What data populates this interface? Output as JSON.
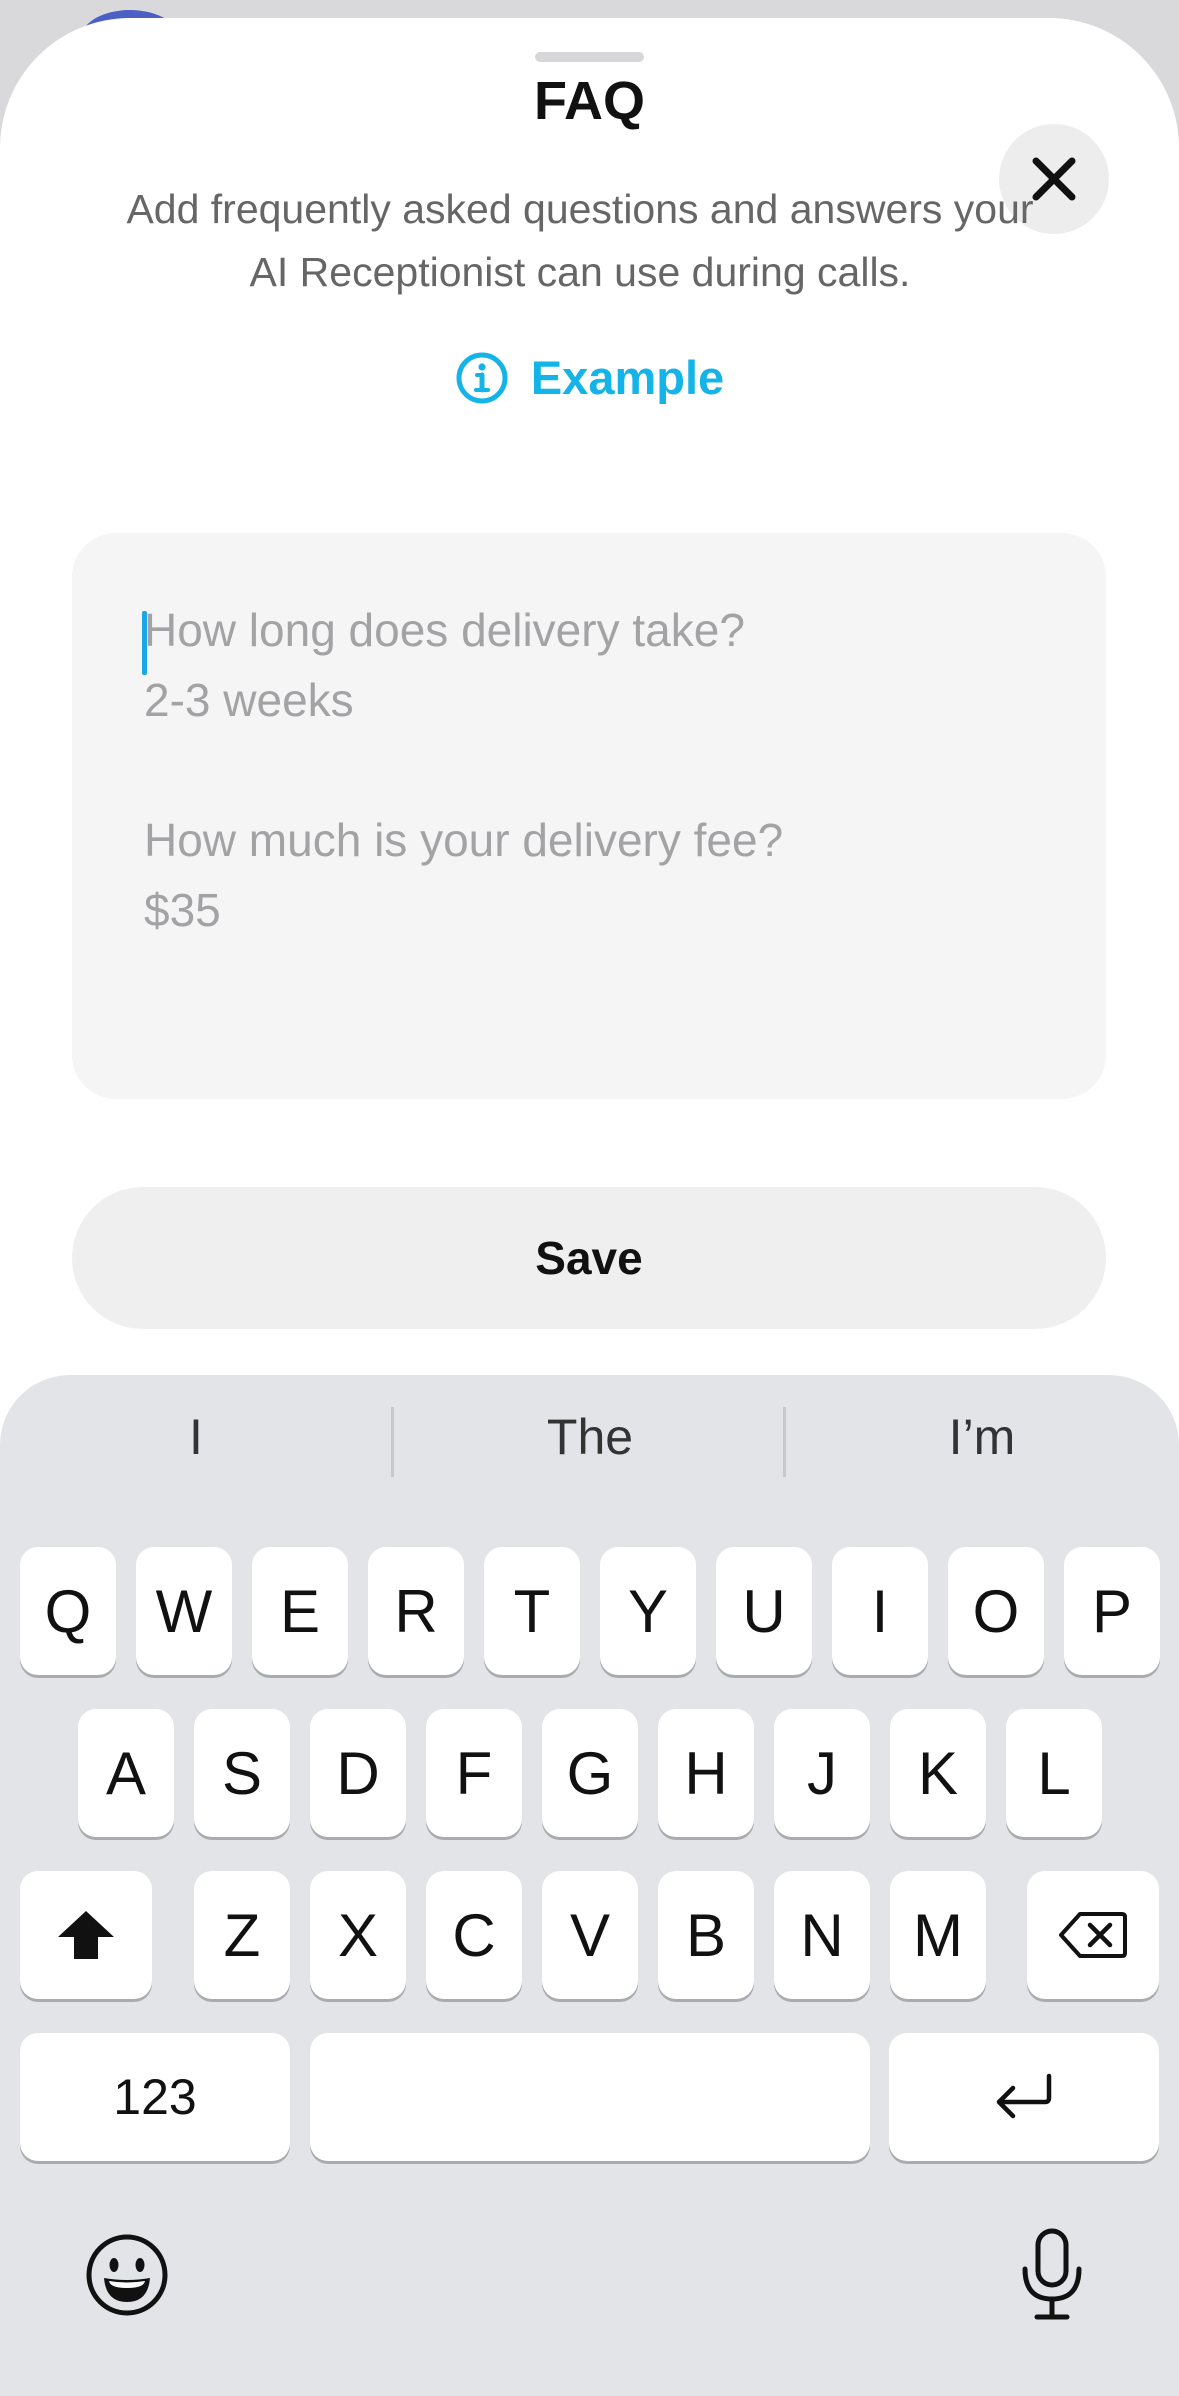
{
  "sheet": {
    "title": "FAQ",
    "subtitle": "Add frequently asked questions and answers your AI Receptionist can use during calls.",
    "example_label": "Example"
  },
  "faq_input": {
    "placeholder": "How long does delivery take?\n2-3 weeks\n\nHow much is your delivery fee?\n$35",
    "value": ""
  },
  "save_label": "Save",
  "keyboard": {
    "suggestions": [
      "I",
      "The",
      "I’m"
    ],
    "row1": [
      "Q",
      "W",
      "E",
      "R",
      "T",
      "Y",
      "U",
      "I",
      "O",
      "P"
    ],
    "row2": [
      "A",
      "S",
      "D",
      "F",
      "G",
      "H",
      "J",
      "K",
      "L"
    ],
    "row3": [
      "Z",
      "X",
      "C",
      "V",
      "B",
      "N",
      "M"
    ],
    "numbers_label": "123",
    "space_label": ""
  },
  "colors": {
    "accent": "#15b4e8",
    "caret": "#1aa7e6"
  }
}
